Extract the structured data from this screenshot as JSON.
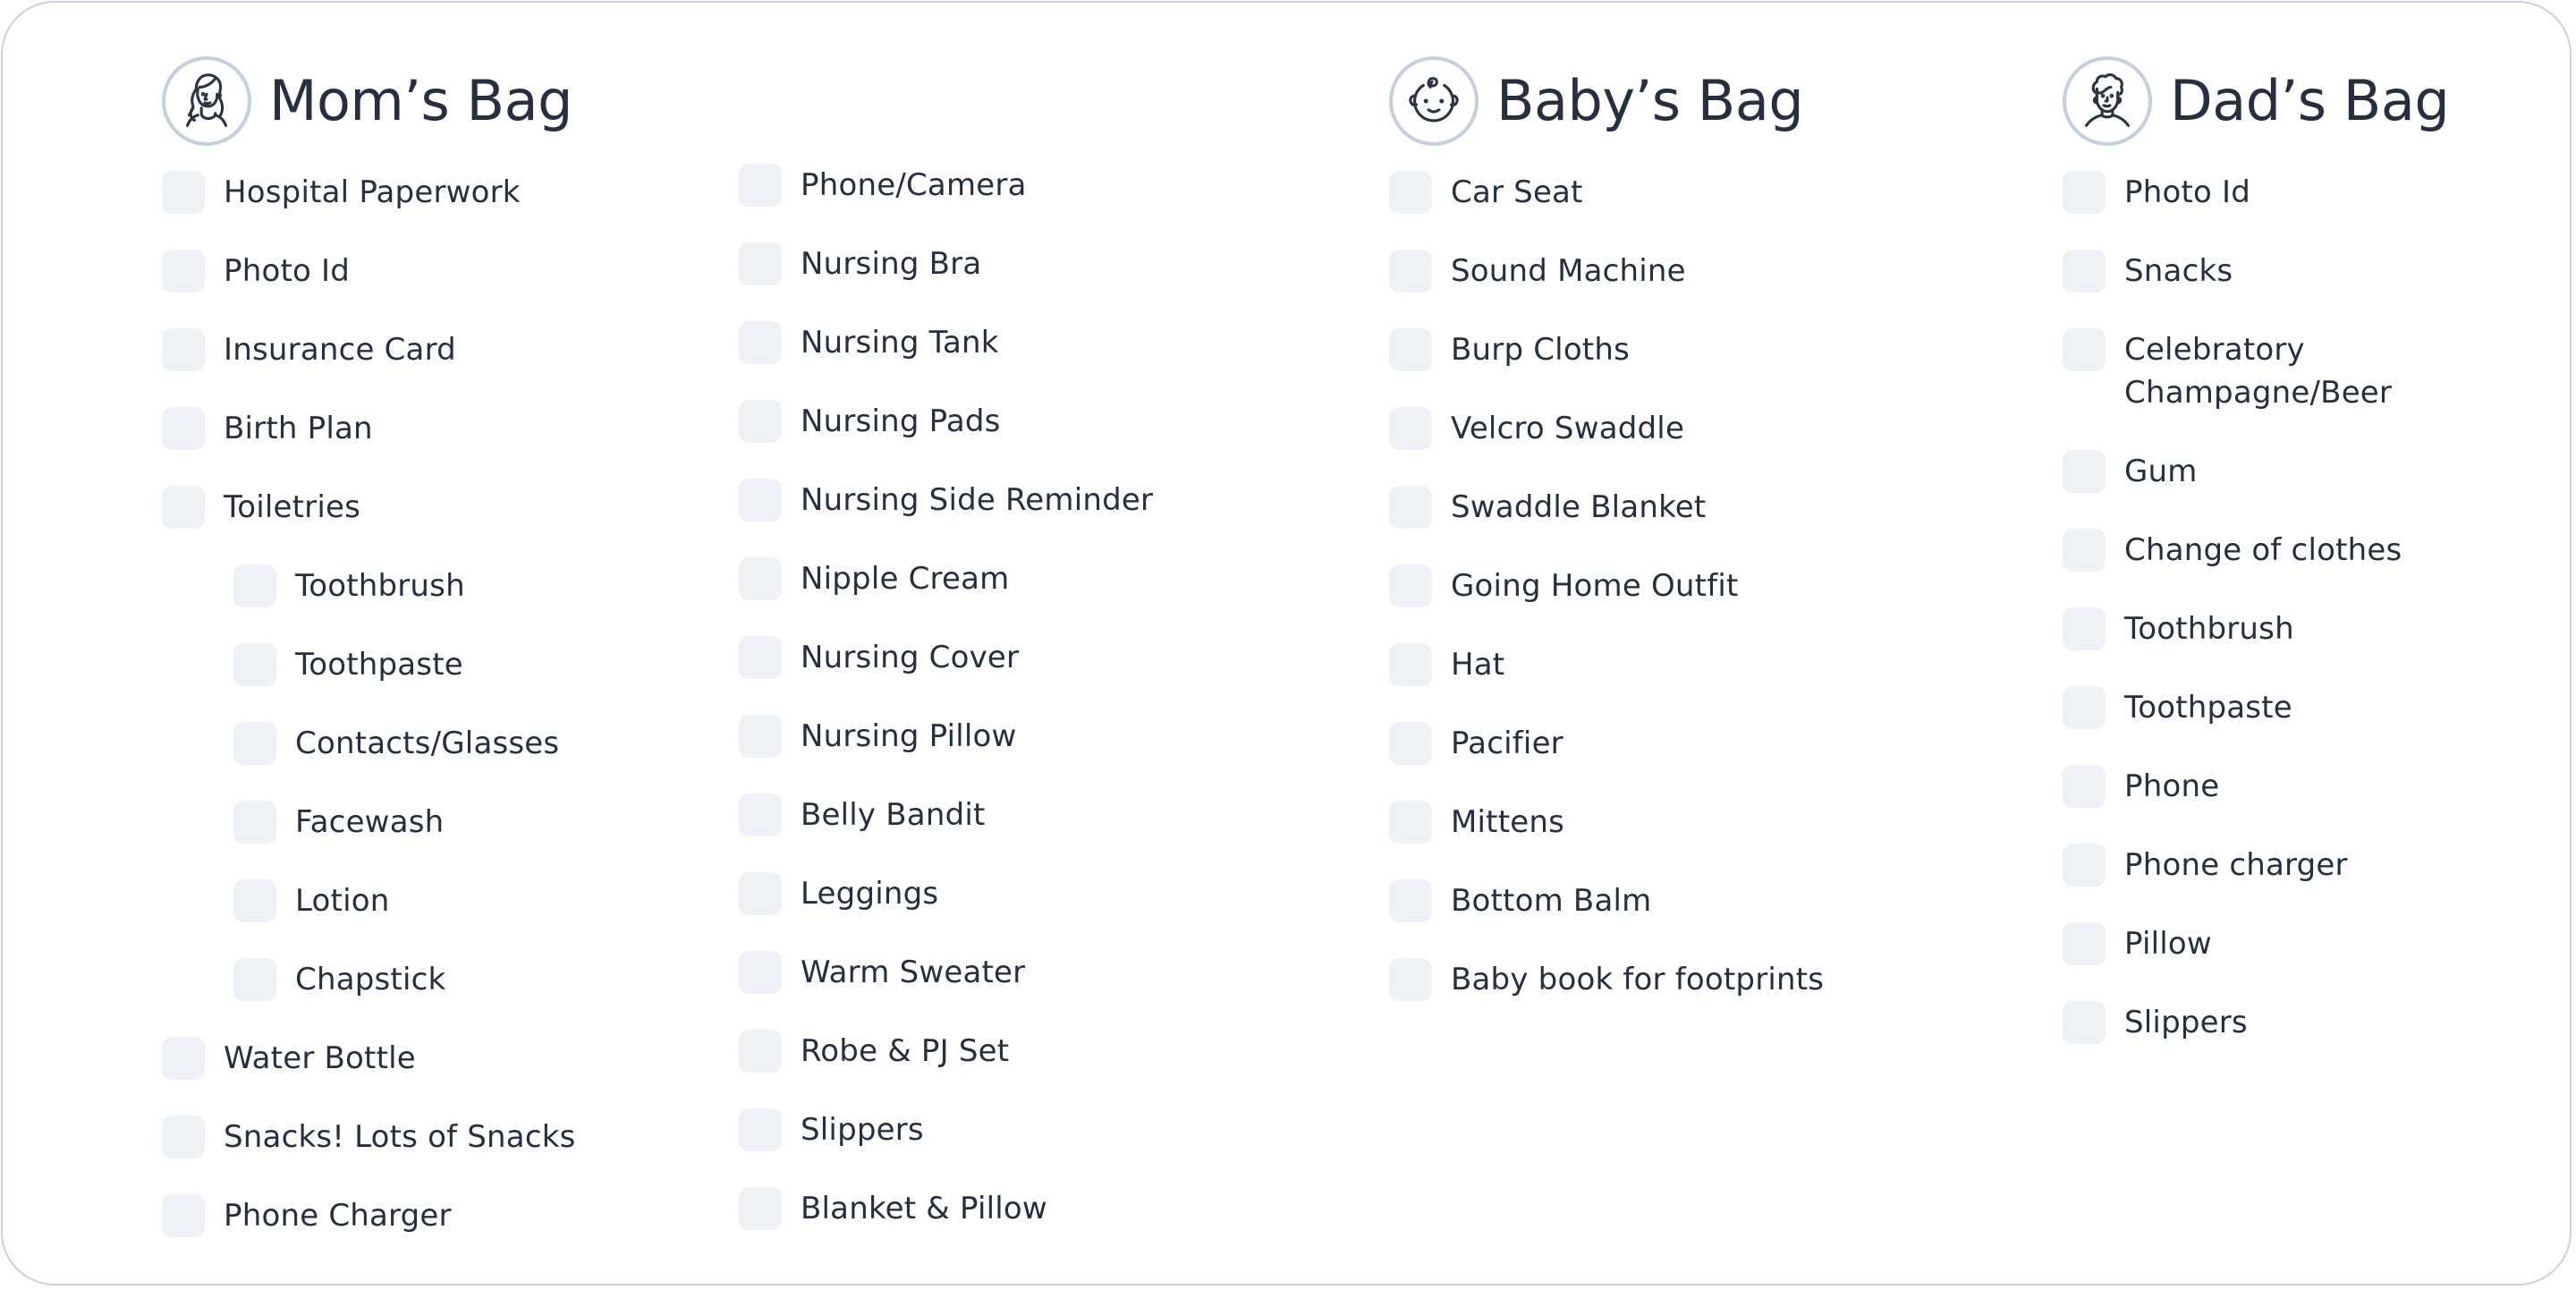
{
  "colors": {
    "text": "#252f40",
    "checkbox_fill": "#eef1f6",
    "card_border": "#c7d2e1",
    "avatar_ring": "#c4cfdf"
  },
  "moms_bag": {
    "title": "Mom’s Bag",
    "icon": "woman-avatar-icon",
    "column_1": [
      {
        "label": "Hospital Paperwork",
        "checked": false
      },
      {
        "label": "Photo Id",
        "checked": false
      },
      {
        "label": "Insurance Card",
        "checked": false
      },
      {
        "label": "Birth Plan",
        "checked": false
      },
      {
        "label": "Toiletries",
        "checked": false
      },
      {
        "label": "Toothbrush",
        "checked": false,
        "sub": true
      },
      {
        "label": "Toothpaste",
        "checked": false,
        "sub": true
      },
      {
        "label": "Contacts/Glasses",
        "checked": false,
        "sub": true
      },
      {
        "label": "Facewash",
        "checked": false,
        "sub": true
      },
      {
        "label": "Lotion",
        "checked": false,
        "sub": true
      },
      {
        "label": "Chapstick",
        "checked": false,
        "sub": true
      },
      {
        "label": "Water Bottle",
        "checked": false
      },
      {
        "label": "Snacks! Lots of Snacks",
        "checked": false
      },
      {
        "label": "Phone Charger",
        "checked": false
      }
    ],
    "column_2": [
      {
        "label": "Phone/Camera",
        "checked": false
      },
      {
        "label": "Nursing Bra",
        "checked": false
      },
      {
        "label": "Nursing Tank",
        "checked": false
      },
      {
        "label": "Nursing Pads",
        "checked": false
      },
      {
        "label": "Nursing Side Reminder",
        "checked": false
      },
      {
        "label": "Nipple Cream",
        "checked": false
      },
      {
        "label": "Nursing Cover",
        "checked": false
      },
      {
        "label": "Nursing Pillow",
        "checked": false
      },
      {
        "label": "Belly Bandit",
        "checked": false
      },
      {
        "label": "Leggings",
        "checked": false
      },
      {
        "label": "Warm Sweater",
        "checked": false
      },
      {
        "label": "Robe & PJ Set",
        "checked": false
      },
      {
        "label": "Slippers",
        "checked": false
      },
      {
        "label": "Blanket & Pillow",
        "checked": false
      }
    ]
  },
  "babys_bag": {
    "title": "Baby’s Bag",
    "icon": "baby-face-icon",
    "items": [
      {
        "label": "Car Seat",
        "checked": false
      },
      {
        "label": "Sound Machine",
        "checked": false
      },
      {
        "label": "Burp Cloths",
        "checked": false
      },
      {
        "label": "Velcro Swaddle",
        "checked": false
      },
      {
        "label": "Swaddle Blanket",
        "checked": false
      },
      {
        "label": "Going Home Outfit",
        "checked": false
      },
      {
        "label": "Hat",
        "checked": false
      },
      {
        "label": "Pacifier",
        "checked": false
      },
      {
        "label": "Mittens",
        "checked": false
      },
      {
        "label": "Bottom Balm",
        "checked": false
      },
      {
        "label": "Baby book for footprints",
        "checked": false
      }
    ]
  },
  "dads_bag": {
    "title": "Dad’s Bag",
    "icon": "man-avatar-icon",
    "items": [
      {
        "label": "Photo Id",
        "checked": false
      },
      {
        "label": "Snacks",
        "checked": false
      },
      {
        "label": "Celebratory Champagne/Beer",
        "checked": false,
        "wrap": true
      },
      {
        "label": "Gum",
        "checked": false
      },
      {
        "label": "Change of clothes",
        "checked": false
      },
      {
        "label": "Toothbrush",
        "checked": false
      },
      {
        "label": "Toothpaste",
        "checked": false
      },
      {
        "label": "Phone",
        "checked": false
      },
      {
        "label": "Phone charger",
        "checked": false
      },
      {
        "label": "Pillow",
        "checked": false
      },
      {
        "label": "Slippers",
        "checked": false
      }
    ]
  }
}
